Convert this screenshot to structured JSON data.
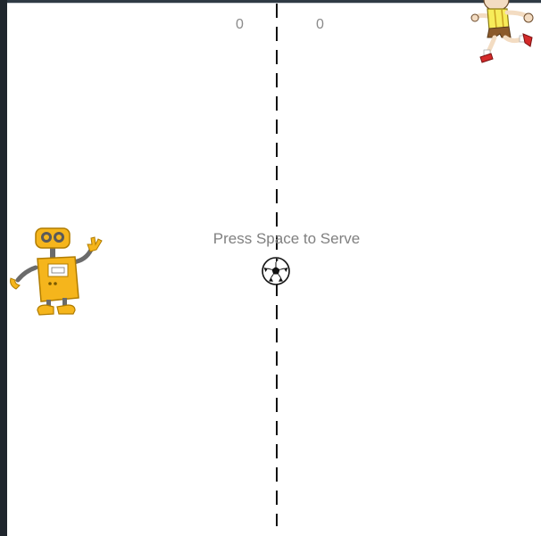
{
  "scoreboard": {
    "left_score": "0",
    "right_score": "0"
  },
  "status": {
    "serve_prompt": "Press Space to Serve"
  },
  "sprites": {
    "left_player": "robot-icon",
    "right_player": "running-boy-icon",
    "ball": "soccer-ball-icon"
  },
  "colors": {
    "background": "#ffffff",
    "center_line": "#111111",
    "score_text": "#8a8a8a",
    "prompt_text": "#808080",
    "robot_body": "#f5b51c",
    "window_edge": "#1f262d"
  }
}
